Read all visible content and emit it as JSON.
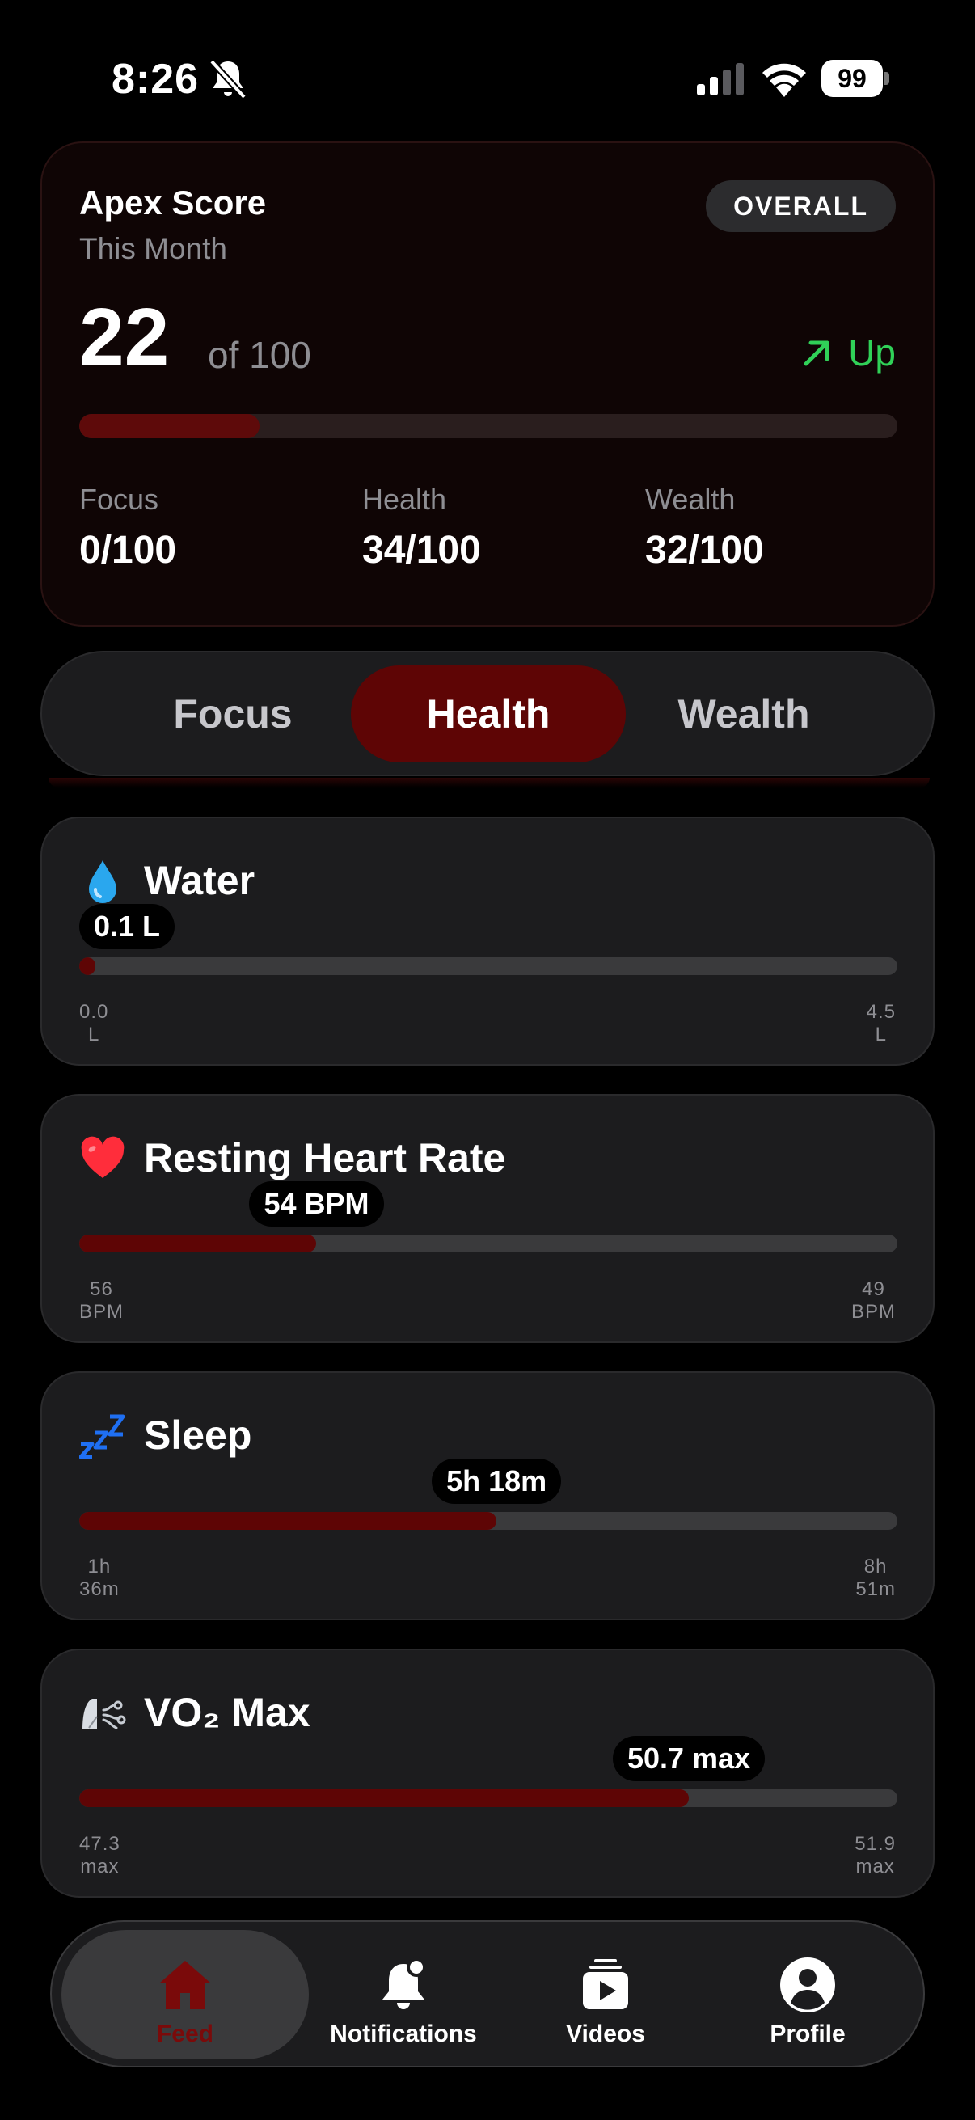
{
  "status": {
    "time": "8:26",
    "battery": "99"
  },
  "apex": {
    "title": "Apex Score",
    "subtitle": "This Month",
    "overall_label": "OVERALL",
    "score": "22",
    "of_label": "of 100",
    "progress_fraction": 0.22,
    "trend_label": "Up",
    "subscores": [
      {
        "label": "Focus",
        "value": "0/100"
      },
      {
        "label": "Health",
        "value": "34/100"
      },
      {
        "label": "Wealth",
        "value": "32/100"
      }
    ]
  },
  "segments": {
    "items": [
      "Focus",
      "Health",
      "Wealth"
    ],
    "active": "Health"
  },
  "metrics": [
    {
      "icon": "water-drop-icon",
      "title": "Water",
      "value": "0.1 L",
      "progress_fraction": 0.02,
      "min": [
        "0.0",
        "L"
      ],
      "max": [
        "4.5",
        "L"
      ]
    },
    {
      "icon": "heart-icon",
      "title": "Resting Heart Rate",
      "value": "54 BPM",
      "progress_fraction": 0.29,
      "min": [
        "56",
        "BPM"
      ],
      "max": [
        "49",
        "BPM"
      ]
    },
    {
      "icon": "zzz-icon",
      "title": "Sleep",
      "value": "5h 18m",
      "progress_fraction": 0.51,
      "min": [
        "1h",
        "36m"
      ],
      "max": [
        "8h",
        "51m"
      ]
    },
    {
      "icon": "lungs-icon",
      "title": "VO₂ Max",
      "value": "50.7 max",
      "progress_fraction": 0.745,
      "min": [
        "47.3",
        "max"
      ],
      "max": [
        "51.9",
        "max"
      ]
    }
  ],
  "tabs": [
    {
      "icon": "home-icon",
      "label": "Feed",
      "active": true
    },
    {
      "icon": "bell-icon",
      "label": "Notifications",
      "active": false
    },
    {
      "icon": "video-icon",
      "label": "Videos",
      "active": false
    },
    {
      "icon": "profile-icon",
      "label": "Profile",
      "active": false
    }
  ],
  "colors": {
    "accent": "#5e0505",
    "trend_up": "#30d158",
    "card_bg": "#1c1c1e",
    "apex_card_bg": "#0f0505"
  }
}
